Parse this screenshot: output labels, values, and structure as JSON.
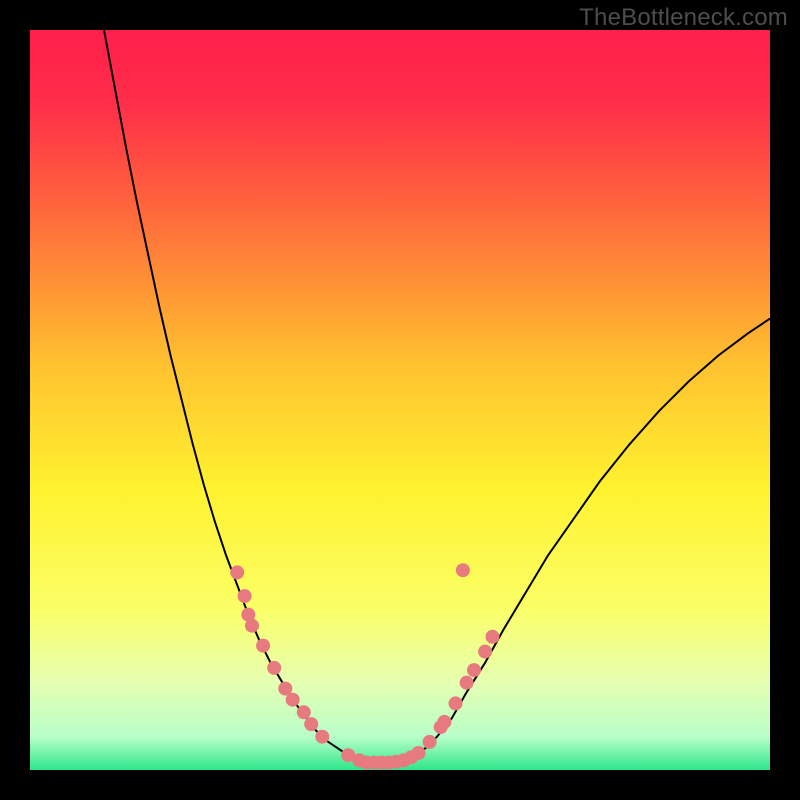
{
  "watermark": "TheBottleneck.com",
  "chart_data": {
    "type": "line",
    "title": "",
    "xlabel": "",
    "ylabel": "",
    "xlim": [
      0,
      100
    ],
    "ylim": [
      0,
      100
    ],
    "grid": false,
    "legend": false,
    "background_gradient_stops": [
      {
        "offset": 0.0,
        "color": "#ff1f4b"
      },
      {
        "offset": 0.1,
        "color": "#ff2e49"
      },
      {
        "offset": 0.25,
        "color": "#ff6a3b"
      },
      {
        "offset": 0.45,
        "color": "#ffc12f"
      },
      {
        "offset": 0.62,
        "color": "#fff22f"
      },
      {
        "offset": 0.78,
        "color": "#fbff66"
      },
      {
        "offset": 0.88,
        "color": "#e6ffb0"
      },
      {
        "offset": 0.955,
        "color": "#b8ffc9"
      },
      {
        "offset": 1.0,
        "color": "#2fe68c"
      }
    ],
    "series": [
      {
        "name": "bottleneck-curve",
        "color": "#000000",
        "width": 2,
        "x": [
          10.0,
          11.5,
          13.0,
          14.5,
          16.0,
          17.5,
          19.0,
          20.5,
          22.0,
          23.5,
          25.0,
          26.5,
          28.0,
          29.5,
          31.0,
          32.5,
          34.0,
          35.5,
          37.0,
          38.5,
          40.0,
          41.5,
          43.0,
          44.5,
          46.0,
          47.5,
          49.0,
          50.5,
          52.0,
          53.5,
          55.0,
          57.0,
          59.0,
          61.5,
          64.0,
          67.0,
          70.0,
          73.5,
          77.0,
          81.0,
          85.0,
          89.0,
          93.0,
          97.0,
          100.0
        ],
        "y": [
          100.0,
          92.0,
          84.0,
          76.5,
          69.5,
          62.5,
          56.0,
          50.0,
          44.0,
          38.5,
          33.5,
          29.0,
          25.0,
          21.0,
          17.5,
          14.5,
          12.0,
          9.5,
          7.5,
          5.5,
          4.0,
          3.0,
          2.0,
          1.3,
          1.0,
          1.0,
          1.0,
          1.3,
          2.0,
          3.0,
          4.5,
          7.0,
          10.5,
          14.5,
          19.0,
          24.0,
          29.0,
          34.0,
          39.0,
          44.0,
          48.5,
          52.5,
          56.0,
          59.0,
          61.0
        ]
      }
    ],
    "markers": {
      "color": "#e77a7e",
      "radius": 7,
      "points": [
        {
          "x": 28.0,
          "y": 26.7
        },
        {
          "x": 29.0,
          "y": 23.5
        },
        {
          "x": 29.5,
          "y": 21.0
        },
        {
          "x": 30.0,
          "y": 19.5
        },
        {
          "x": 31.5,
          "y": 16.8
        },
        {
          "x": 33.0,
          "y": 13.8
        },
        {
          "x": 34.5,
          "y": 11.0
        },
        {
          "x": 35.5,
          "y": 9.5
        },
        {
          "x": 37.0,
          "y": 7.8
        },
        {
          "x": 38.0,
          "y": 6.2
        },
        {
          "x": 39.5,
          "y": 4.5
        },
        {
          "x": 43.0,
          "y": 2.0
        },
        {
          "x": 44.5,
          "y": 1.3
        },
        {
          "x": 45.5,
          "y": 1.0
        },
        {
          "x": 46.5,
          "y": 1.0
        },
        {
          "x": 47.5,
          "y": 1.0
        },
        {
          "x": 48.5,
          "y": 1.0
        },
        {
          "x": 49.5,
          "y": 1.1
        },
        {
          "x": 50.5,
          "y": 1.3
        },
        {
          "x": 51.5,
          "y": 1.7
        },
        {
          "x": 52.5,
          "y": 2.3
        },
        {
          "x": 54.0,
          "y": 3.8
        },
        {
          "x": 55.5,
          "y": 5.8
        },
        {
          "x": 56.0,
          "y": 6.5
        },
        {
          "x": 57.5,
          "y": 9.0
        },
        {
          "x": 59.0,
          "y": 11.8
        },
        {
          "x": 60.0,
          "y": 13.5
        },
        {
          "x": 61.5,
          "y": 16.0
        },
        {
          "x": 62.5,
          "y": 18.0
        },
        {
          "x": 58.5,
          "y": 27.0
        }
      ]
    }
  }
}
